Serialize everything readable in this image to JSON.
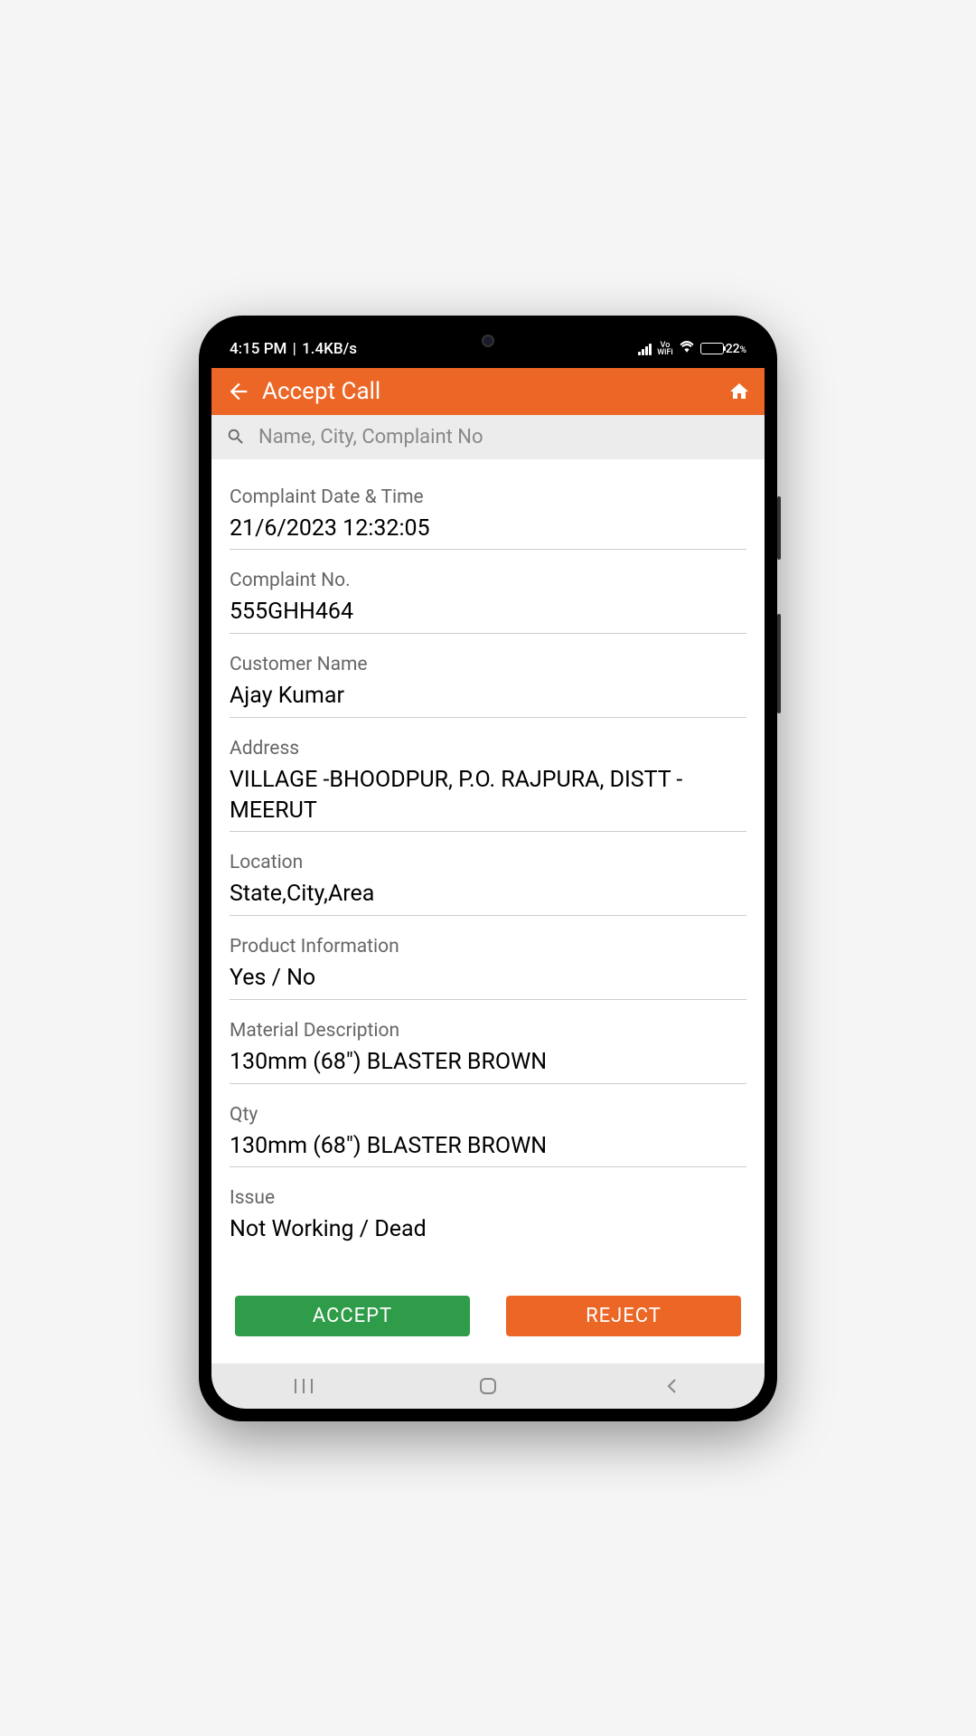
{
  "status": {
    "time": "4:15 PM",
    "net_speed": "1.4KB/s",
    "vowifi_top": "Vo",
    "vowifi_bottom": "WiFi",
    "battery_pct": "22",
    "battery_pct_suffix": "%"
  },
  "header": {
    "title": "Accept Call"
  },
  "search": {
    "placeholder": "Name, City, Complaint No"
  },
  "fields": {
    "complaint_datetime": {
      "label": "Complaint Date & Time",
      "value": "21/6/2023  12:32:05"
    },
    "complaint_no": {
      "label": "Complaint No.",
      "value": "555GHH464"
    },
    "customer_name": {
      "label": "Customer Name",
      "value": "Ajay Kumar"
    },
    "address": {
      "label": "Address",
      "value": "VILLAGE -BHOODPUR, P.O. RAJPURA, DISTT - MEERUT"
    },
    "location": {
      "label": "Location",
      "value": "State,City,Area"
    },
    "product_info": {
      "label": "Product Information",
      "value": "Yes / No"
    },
    "material_desc": {
      "label": "Material Description",
      "value": "130mm (68\") BLASTER BROWN"
    },
    "qty": {
      "label": "Qty",
      "value": "130mm (68\") BLASTER BROWN"
    },
    "issue": {
      "label": "Issue",
      "value": "Not Working / Dead"
    }
  },
  "actions": {
    "accept": "ACCEPT",
    "reject": "REJECT"
  }
}
